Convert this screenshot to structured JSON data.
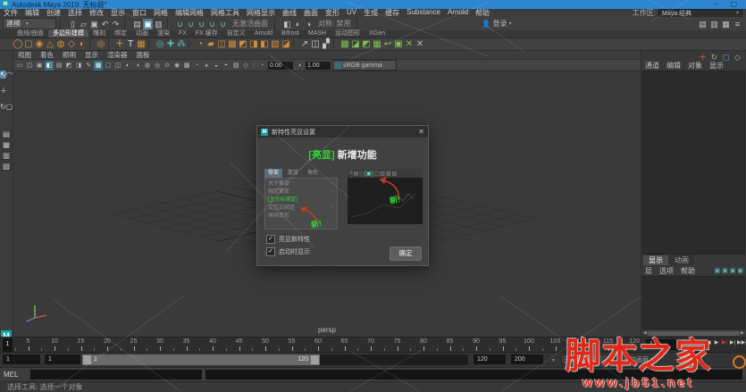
{
  "colors": {
    "titlebar_blue": "#2e86d0",
    "highlight_green": "#2ed32e",
    "arrow_red": "#c23a28",
    "shelf_orange": "#d78f35",
    "icon_teal": "#5ab6ba",
    "shelf_green": "#7cc24c",
    "watermark_red": "#e02818"
  },
  "titlebar": {
    "title": "Autodesk Maya 2019: 无标题*",
    "minimize": "–",
    "maximize": "▢",
    "logo": "M"
  },
  "menubar": {
    "items": [
      "文件",
      "编辑",
      "创建",
      "选择",
      "修改",
      "显示",
      "窗口",
      "网格",
      "编辑网格",
      "网格工具",
      "网格显示",
      "曲线",
      "曲面",
      "变形",
      "UV",
      "生成",
      "缓存",
      "Substance",
      "Arnold",
      "帮助"
    ],
    "workspace_label": "工作区:",
    "workspace_value": "Maya 经典",
    "caret": "▾"
  },
  "statusline": {
    "menuset": "建模",
    "live_surface": "无激活曲面",
    "symmetry": "对称: 禁用",
    "signin": "登录",
    "person": "👤",
    "file_icons": [
      {
        "n": "new-scene-icon",
        "g": "▯"
      },
      {
        "n": "open-scene-icon",
        "g": "▱"
      },
      {
        "n": "save-scene-icon",
        "g": "▣"
      },
      {
        "n": "undo-icon",
        "g": "↶"
      },
      {
        "n": "redo-icon",
        "g": "↷"
      }
    ],
    "select_icons": [
      {
        "n": "select-hierarchy-icon",
        "g": "▤"
      },
      {
        "n": "select-object-icon",
        "g": "▣",
        "hl": true
      },
      {
        "n": "select-component-icon",
        "g": "▥"
      }
    ],
    "snap_icons": [
      {
        "n": "snap-grid-icon",
        "g": "∪"
      },
      {
        "n": "snap-curve-icon",
        "g": "∪"
      },
      {
        "n": "snap-point-icon",
        "g": "∪"
      },
      {
        "n": "snap-plane-icon",
        "g": "∪"
      },
      {
        "n": "snap-view-icon",
        "g": "∪"
      }
    ],
    "tool_icons": [
      {
        "n": "construction-history-icon",
        "g": "◧"
      },
      {
        "n": "render-icon",
        "g": "◐"
      },
      {
        "n": "ipr-render-icon",
        "g": "◑"
      }
    ],
    "right_icons": [
      {
        "n": "modeling-toolkit-icon",
        "g": "▤"
      },
      {
        "n": "attribute-editor-icon",
        "g": "▥"
      },
      {
        "n": "tool-settings-icon",
        "g": "▦"
      },
      {
        "n": "channel-box-icon",
        "g": "≡"
      }
    ]
  },
  "shelf": {
    "active_tab": "多边形建模",
    "tabs": [
      "曲线/曲面",
      "多边形建模",
      "雕刻",
      "绑定",
      "动画",
      "渲染",
      "FX",
      "FX 缓存",
      "自定义",
      "Arnold",
      "Bifrost",
      "MASH",
      "运动图形",
      "XGen"
    ],
    "icons": [
      {
        "n": "poly-sphere-icon",
        "g": "◯",
        "c": "#d78f35"
      },
      {
        "n": "poly-cube-icon",
        "g": "▢",
        "c": "#d78f35"
      },
      {
        "n": "poly-cylinder-icon",
        "g": "◉",
        "c": "#d78f35"
      },
      {
        "n": "poly-cone-icon",
        "g": "△",
        "c": "#d78f35"
      },
      {
        "n": "poly-torus-icon",
        "g": "◍",
        "c": "#d78f35"
      },
      {
        "n": "poly-plane-icon",
        "g": "◇",
        "c": "#d78f35"
      },
      {
        "n": "poly-disc-icon",
        "g": "◐",
        "c": "#d78f35"
      },
      {
        "g": "|"
      },
      {
        "n": "super-shape-icon",
        "g": "◎",
        "c": "#d78f35"
      },
      {
        "g": "|"
      },
      {
        "n": "curve-tool-icon",
        "g": "＋",
        "c": "#e8c44a"
      },
      {
        "n": "type-tool-icon",
        "g": "T",
        "c": "#e8e8e8"
      },
      {
        "n": "svg-tool-icon",
        "g": "▦",
        "c": "#d78f35"
      },
      {
        "g": "|"
      },
      {
        "n": "joint-tool-icon",
        "g": "◎",
        "c": "#5ab6ba"
      },
      {
        "n": "ik-handle-icon",
        "g": "✚",
        "c": "#5ab6ba"
      },
      {
        "n": "skin-bind-icon",
        "g": "⁂",
        "c": "#5ab6ba"
      },
      {
        "g": "|"
      },
      {
        "n": "combine-icon",
        "g": "◔",
        "c": "#d78f35"
      },
      {
        "n": "separate-icon",
        "g": "▰",
        "c": "#d78f35"
      },
      {
        "n": "boolean-icon",
        "g": "◫",
        "c": "#d78f35"
      },
      {
        "n": "smooth-icon",
        "g": "▩",
        "c": "#d78f35"
      },
      {
        "n": "extrude-icon",
        "g": "◩",
        "c": "#d78f35"
      },
      {
        "n": "bevel-icon",
        "g": "◨",
        "c": "#d78f35"
      },
      {
        "n": "bridge-icon",
        "g": "◧",
        "c": "#d78f35"
      },
      {
        "n": "multi-cut-icon",
        "g": "▧",
        "c": "#d78f35"
      },
      {
        "n": "target-weld-icon",
        "g": "◪",
        "c": "#d78f35"
      },
      {
        "g": "|"
      },
      {
        "n": "mirror-icon",
        "g": "↗",
        "c": "#c8c8c8"
      },
      {
        "n": "quad-draw-icon",
        "g": "◫",
        "c": "#c8c8c8"
      },
      {
        "n": "wireframe-icon",
        "g": "▞",
        "c": "#c8c8c8"
      },
      {
        "g": "|"
      },
      {
        "n": "uv-planar-icon",
        "g": "▩",
        "c": "#7cc24c"
      },
      {
        "n": "uv-auto-icon",
        "g": "◪",
        "c": "#7cc24c"
      },
      {
        "n": "uv-cylindrical-icon",
        "g": "◩",
        "c": "#7cc24c"
      },
      {
        "n": "uv-cube-icon",
        "g": "▦",
        "c": "#7cc24c"
      },
      {
        "n": "uv-contour-icon",
        "g": "↩",
        "c": "#7cc24c"
      },
      {
        "n": "uv-editor-icon",
        "g": "▣",
        "c": "#7cc24c"
      },
      {
        "n": "uv-cut-icon",
        "g": "✕",
        "c": "#7cc24c"
      },
      {
        "n": "uv-sew-icon",
        "g": "✕",
        "c": "#bbbbbb"
      }
    ]
  },
  "toolbox": {
    "tools": [
      {
        "n": "select-tool",
        "g": "↖",
        "sel": true
      },
      {
        "n": "lasso-tool",
        "g": "◠"
      },
      {
        "n": "paint-select-tool",
        "g": "✎"
      },
      {
        "n": "move-tool",
        "g": "＋"
      },
      {
        "n": "rotate-tool",
        "g": "↻"
      },
      {
        "n": "scale-tool",
        "g": "▢"
      }
    ],
    "layouts": [
      {
        "n": "layout-single-pane",
        "g": "▤"
      },
      {
        "n": "layout-four-pane",
        "g": "▦"
      },
      {
        "n": "layout-two-pane",
        "g": "▥"
      },
      {
        "n": "layout-outliner-persp",
        "g": "▧"
      }
    ],
    "logo": "M"
  },
  "panel_menus": [
    "视图",
    "着色",
    "照明",
    "显示",
    "渲染器",
    "面板"
  ],
  "viewport": {
    "camera_label": "persp",
    "exposure": "0.00",
    "gamma_value": "1.00",
    "gamma_mode": "sRGB gamma",
    "toolbar_icons": [
      {
        "n": "select-camera-icon",
        "g": "▭"
      },
      {
        "n": "lock-camera-icon",
        "g": "◫"
      },
      {
        "n": "camera-attributes-icon",
        "g": "▣"
      },
      {
        "n": "bookmark-icon",
        "g": "◧",
        "hl": true
      },
      {
        "n": "image-plane-icon",
        "g": "▤"
      },
      {
        "n": "2d-pan-zoom-icon",
        "g": "◩"
      },
      {
        "n": "oversampling-icon",
        "g": "◨"
      },
      {
        "n": "grease-pencil-icon",
        "g": "✎"
      },
      {
        "n": "grid-toggle-icon",
        "g": "▦",
        "hl": true
      },
      {
        "n": "film-gate-icon",
        "g": "▢"
      },
      {
        "n": "resolution-gate-icon",
        "g": "◫"
      },
      {
        "n": "gate-mask-icon",
        "g": "◐"
      },
      {
        "n": "field-chart-icon",
        "g": "◑"
      },
      {
        "n": "safe-action-icon",
        "g": "◍"
      },
      {
        "n": "safe-title-icon",
        "g": "◎"
      },
      {
        "n": "wireframe-mode-icon",
        "g": "⊙"
      },
      {
        "n": "shaded-mode-icon",
        "g": "◉"
      },
      {
        "n": "textured-mode-icon",
        "g": "▩"
      },
      {
        "n": "lighting-mode-icon",
        "g": "◔"
      },
      {
        "n": "shadows-icon",
        "g": "◕"
      },
      {
        "n": "ao-icon",
        "g": "◒"
      },
      {
        "n": "aa-icon",
        "g": "◓"
      },
      {
        "n": "xray-icon",
        "g": "▨"
      },
      {
        "n": "isolate-select-icon",
        "g": "◇"
      }
    ]
  },
  "channel_box": {
    "menus": [
      "通道",
      "编辑",
      "对象",
      "显示"
    ],
    "mini_icons": [
      {
        "n": "translate-axis-icon",
        "g": "＋",
        "c": "#cf6a5a"
      },
      {
        "n": "rotate-axis-icon",
        "g": "↻",
        "c": "#8fb36a"
      },
      {
        "n": "scale-axis-icon",
        "g": "▢",
        "c": "#6a8fcf"
      },
      {
        "n": "speed-icon",
        "g": "◇",
        "c": "#b0b0b0"
      }
    ]
  },
  "layer_editor": {
    "tabs": [
      "显示",
      "动画"
    ],
    "active_tab": "显示",
    "menus": [
      "层",
      "选项",
      "帮助"
    ],
    "icons": [
      {
        "n": "new-empty-layer-icon",
        "g": "▣"
      },
      {
        "n": "new-layer-selected-icon",
        "g": "▣"
      },
      {
        "n": "move-layer-up-icon",
        "g": "▣"
      },
      {
        "n": "move-layer-down-icon",
        "g": "▣"
      }
    ]
  },
  "timeline": {
    "current_frame": "1",
    "current_time_field": "1",
    "ticks": [
      5,
      10,
      15,
      20,
      25,
      30,
      35,
      40,
      45,
      50,
      55,
      60,
      65,
      70,
      75,
      80,
      85,
      90,
      95,
      100,
      105,
      110,
      115,
      120
    ],
    "playback": [
      {
        "n": "go-to-start-button",
        "g": "|◀◀"
      },
      {
        "n": "step-back-frame-button",
        "g": "|◀"
      },
      {
        "n": "step-back-key-button",
        "g": "|◀",
        "red": true
      },
      {
        "n": "play-backwards-button",
        "g": "◀"
      },
      {
        "n": "play-forwards-button",
        "g": "▶"
      },
      {
        "n": "step-forward-key-button",
        "g": "▶|",
        "red": true
      },
      {
        "n": "step-forward-frame-button",
        "g": "▶|"
      },
      {
        "n": "go-to-end-button",
        "g": "▶▶|"
      }
    ]
  },
  "range_slider": {
    "anim_start": "1",
    "playback_start": "1",
    "bar_start_label": "1",
    "bar_end_label": "120",
    "playback_end": "120",
    "anim_end": "200",
    "character_set": "无角色集",
    "anim_layer": "无动画层",
    "caret": "▾"
  },
  "command_line": {
    "label": "MEL"
  },
  "help_line": {
    "text": "选择工具: 选择一个对象"
  },
  "watermark": {
    "title": "脚本之家",
    "url": "www.jb51.net"
  },
  "dialog": {
    "title": "新特性亮显设置",
    "logo": "M",
    "close": "✕",
    "heading_highlight": "[亮显]",
    "heading_rest": " 新增功能",
    "left_preview": {
      "tabs": [
        "骨架",
        "蒙皮",
        "角色"
      ],
      "active_tab": "骨架",
      "items": [
        {
          "t": "关于蒙皮",
          "box": true
        },
        {
          "t": "绑定蒙皮",
          "box": true
        },
        {
          "t": "[主光标绑定]",
          "green": true
        },
        {
          "t": "交互式绑定",
          "box": true
        },
        {
          "t": "烘焙变形"
        }
      ],
      "new_label": "新!"
    },
    "right_preview": {
      "new_label": "新!",
      "toolbar": [
        {
          "g": "≡"
        },
        {
          "g": "▤"
        },
        {
          "g": "◇"
        },
        {
          "g": "▣",
          "bracket": true
        },
        {
          "g": "▢"
        },
        {
          "g": "▥"
        },
        {
          "g": "▧"
        },
        {
          "g": "▨"
        }
      ]
    },
    "checkboxes": [
      {
        "label": "亮显新特性",
        "checked": true
      },
      {
        "label": "启动时显示",
        "checked": true
      }
    ],
    "ok_label": "确定",
    "check_glyph": "✓"
  }
}
